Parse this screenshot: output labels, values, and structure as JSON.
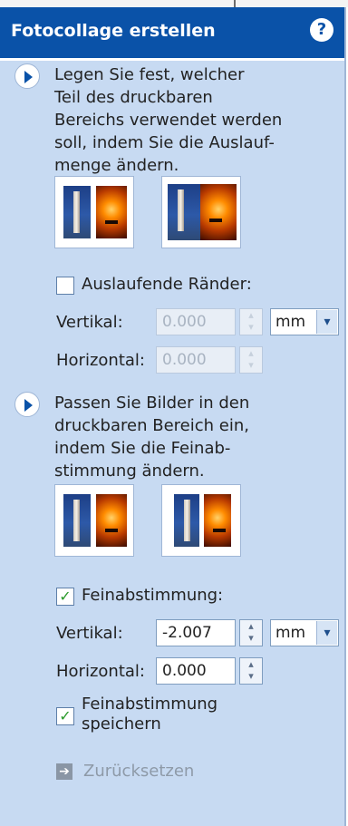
{
  "header": {
    "title": "Fotocollage erstellen",
    "help_icon": "question-circle-icon",
    "help_glyph": "?"
  },
  "section1": {
    "description": [
      "Legen Sie fest, welcher",
      "Teil des druckbaren",
      "Bereichs verwendet werden",
      "soll, indem Sie die Auslauf-",
      "menge ändern."
    ]
  },
  "bleed": {
    "checkbox_label": "Auslaufende Ränder:",
    "checked": false,
    "vertical_label": "Vertikal:",
    "vertical_value": "0.000",
    "horizontal_label": "Horizontal:",
    "horizontal_value": "0.000",
    "unit": "mm"
  },
  "section2": {
    "description": [
      "Passen Sie Bilder in den",
      "druckbaren Bereich ein,",
      "indem Sie die Feinab-",
      "stimmung ändern."
    ]
  },
  "finetune": {
    "checkbox_label": "Feinabstimmung:",
    "checked": true,
    "vertical_label": "Vertikal:",
    "vertical_value": "-2.007",
    "horizontal_label": "Horizontal:",
    "horizontal_value": "0.000",
    "unit": "mm",
    "save_label": [
      "Feinabstimmung",
      "speichern"
    ],
    "save_checked": true
  },
  "reset": {
    "label": "Zurücksetzen"
  },
  "glyphs": {
    "check": "✓",
    "dropdown": "▾",
    "spin_up": "▴",
    "spin_down": "▾",
    "reset": "➔"
  },
  "colors": {
    "header_bg": "#0a52a8",
    "panel_bg": "#c7daf2",
    "check_green": "#2a9a2a"
  }
}
